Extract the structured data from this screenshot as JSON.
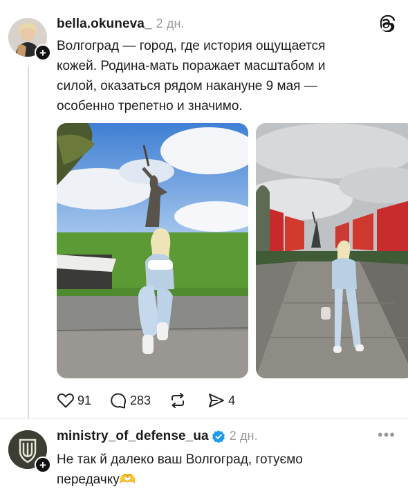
{
  "post1": {
    "username": "bella.okuneva_",
    "time": "2 дн.",
    "text": "Волгоград — город, где история ощущается кожей.  Родина-мать поражает масштабом и силой, оказаться рядом накануне 9 мая — особенно трепетно и значимо.",
    "likes": "91",
    "comments": "283",
    "shares": "4",
    "app_icon": "threads-logo-icon"
  },
  "post2": {
    "username": "ministry_of_defense_ua",
    "time": "2 дн.",
    "text": "Не так й далеко ваш Волгоград, готуємо передачку🫶",
    "more_icon": "more-dots-icon"
  },
  "colors": {
    "verified": "#1d9bf0",
    "muted": "#9a9a9a",
    "divider": "#d9d9d9"
  }
}
